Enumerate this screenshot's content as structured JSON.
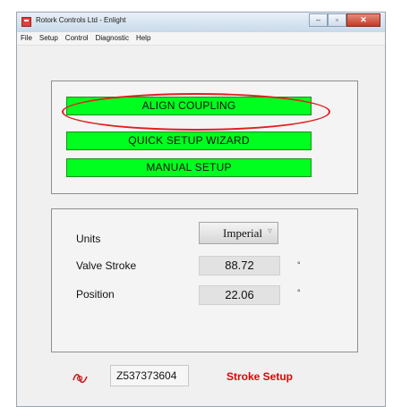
{
  "window": {
    "title": "Rotork Controls Ltd - Enlight",
    "controls": {
      "minimize": "–",
      "maximize": "▫",
      "close": "✕"
    }
  },
  "menu": [
    "File",
    "Setup",
    "Control",
    "Diagnostic",
    "Help"
  ],
  "setup_buttons": {
    "align": "ALIGN COUPLING",
    "quick": "QUICK SETUP WIZARD",
    "manual": "MANUAL SETUP"
  },
  "settings": {
    "units_label": "Units",
    "units_value": "Imperial",
    "valve_stroke_label": "Valve Stroke",
    "valve_stroke_value": "88.72",
    "valve_stroke_unit": "°",
    "position_label": "Position",
    "position_value": "22.06",
    "position_unit": "°"
  },
  "footer": {
    "serial": "Z537373604",
    "status": "Stroke Setup"
  },
  "colors": {
    "button_green": "#00ff1e",
    "highlight": "#e0201e",
    "status_red": "#e60000"
  },
  "icons": {
    "status": "signal-wave-icon",
    "units_dropdown": "chevron-down-icon"
  }
}
